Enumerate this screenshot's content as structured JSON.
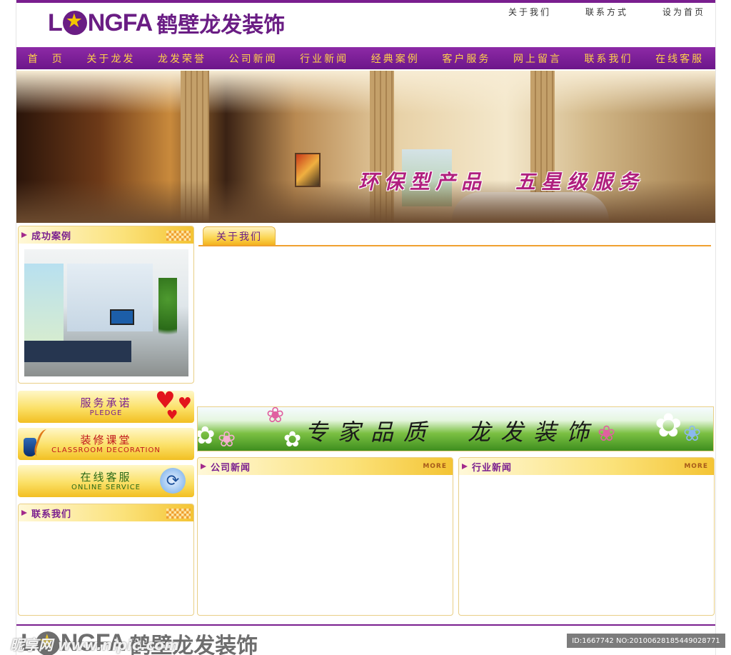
{
  "header": {
    "logo_latin_pre": "L",
    "logo_latin_post": "NGFA",
    "logo_cn": "鹤壁龙发装饰",
    "links": [
      "关于我们",
      "联系方式",
      "设为首页"
    ]
  },
  "nav": {
    "items": [
      "首　页",
      "关于龙发",
      "龙发荣誉",
      "公司新闻",
      "行业新闻",
      "经典案例",
      "客户服务",
      "网上留言",
      "联系我们",
      "在线客服"
    ]
  },
  "banner": {
    "slogan_left": "环保型产品",
    "slogan_right": "五星级服务"
  },
  "sidebar": {
    "cases_title": "成功案例",
    "promos": [
      {
        "cn": "服务承诺",
        "en": "PLEDGE"
      },
      {
        "cn": "装修课堂",
        "en": "CLASSROOM DECORATION"
      },
      {
        "cn": "在线客服",
        "en": "ONLINE SERVICE"
      }
    ],
    "contact_title": "联系我们"
  },
  "main": {
    "about_tab": "关于我们",
    "flower_slogan_left": "专家品质",
    "flower_slogan_right": "龙发装饰",
    "company_news_title": "公司新闻",
    "industry_news_title": "行业新闻",
    "more_label": "MORE"
  },
  "footer": {
    "logo_latin_pre": "L",
    "logo_latin_post": "NGFA",
    "logo_cn": "鹤壁龙发装饰"
  },
  "watermark": {
    "left": "昵享网 www.nipic.com",
    "right": "ID:1667742 NO:20100628185449028771"
  },
  "colors": {
    "brand_purple": "#7a1f8f",
    "nav_text": "#ffd24a",
    "accent_orange": "#f0a030"
  }
}
